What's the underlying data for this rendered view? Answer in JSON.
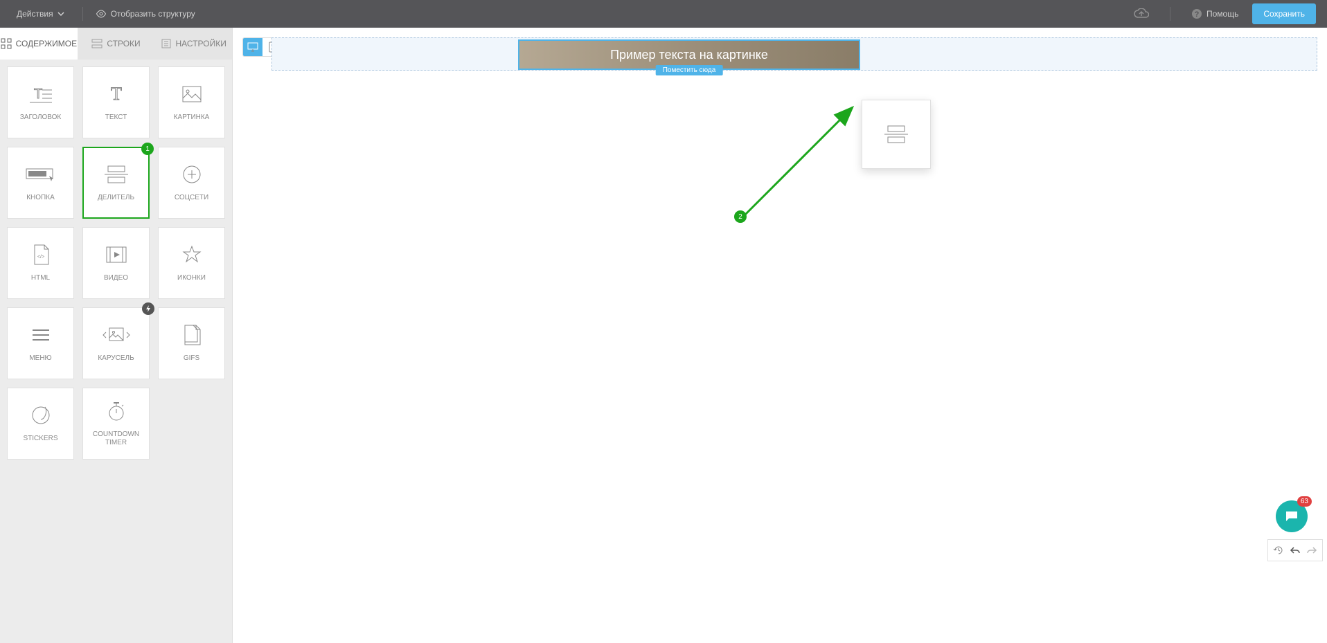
{
  "topbar": {
    "actions_label": "Действия",
    "structure_label": "Отобразить структуру",
    "help_label": "Помощь",
    "save_label": "Сохранить"
  },
  "sidebar": {
    "tabs": [
      {
        "label": "СОДЕРЖИМОЕ",
        "active": true
      },
      {
        "label": "СТРОКИ",
        "active": false
      },
      {
        "label": "НАСТРОЙКИ",
        "active": false
      }
    ],
    "blocks": [
      {
        "label": "ЗАГОЛОВОК",
        "icon": "heading",
        "selected": false
      },
      {
        "label": "ТЕКСТ",
        "icon": "text",
        "selected": false
      },
      {
        "label": "КАРТИНКА",
        "icon": "image",
        "selected": false
      },
      {
        "label": "КНОПКА",
        "icon": "button",
        "selected": false
      },
      {
        "label": "ДЕЛИТЕЛЬ",
        "icon": "divider",
        "selected": true,
        "badge_num": "1"
      },
      {
        "label": "СОЦСЕТИ",
        "icon": "social",
        "selected": false
      },
      {
        "label": "HTML",
        "icon": "html",
        "selected": false
      },
      {
        "label": "ВИДЕО",
        "icon": "video",
        "selected": false
      },
      {
        "label": "ИКОНКИ",
        "icon": "star",
        "selected": false
      },
      {
        "label": "МЕНЮ",
        "icon": "menu",
        "selected": false
      },
      {
        "label": "КАРУСЕЛЬ",
        "icon": "carousel",
        "selected": false,
        "badge_bolt": true
      },
      {
        "label": "GIFS",
        "icon": "gifs",
        "selected": false
      },
      {
        "label": "STICKERS",
        "icon": "stickers",
        "selected": false
      },
      {
        "label": "COUNTDOWN TIMER",
        "icon": "timer",
        "selected": false
      }
    ]
  },
  "canvas": {
    "image_text": "Пример текста на картинке",
    "drop_label": "Поместить сюда",
    "arrow_badge": "2"
  },
  "chat": {
    "badge_count": "63"
  }
}
